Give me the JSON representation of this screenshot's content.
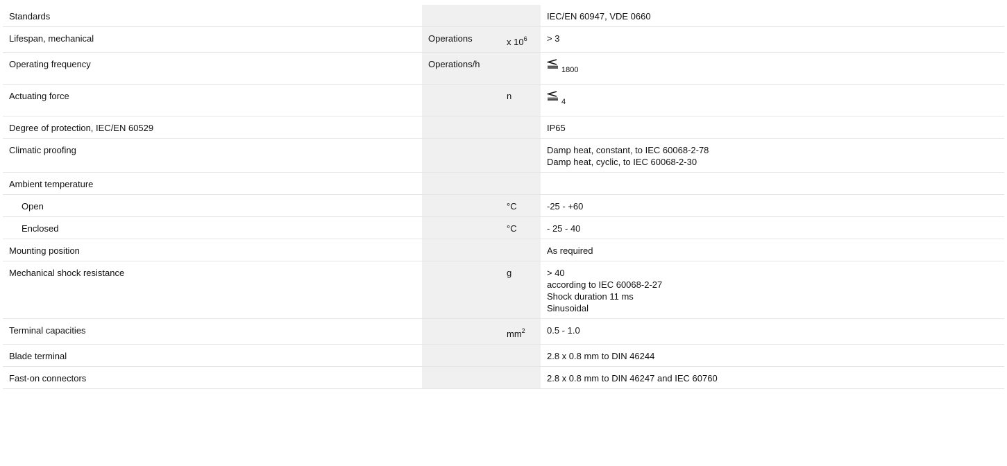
{
  "rows": [
    {
      "label": "Standards",
      "unit": "",
      "mult": "",
      "value": [
        "IEC/EN 60947, VDE 0660"
      ]
    },
    {
      "label": "Lifespan, mechanical",
      "unit": "Operations",
      "mult": "x 10",
      "mult_sup": "6",
      "value": [
        "> 3"
      ]
    },
    {
      "label": "Operating frequency",
      "unit": "Operations/h",
      "mult": "",
      "value_icon": "less-or-equal-icon",
      "value_sub": "1800"
    },
    {
      "label": "Actuating force",
      "unit": "",
      "mult": "n",
      "value_icon": "less-or-equal-icon",
      "value_sub": "4"
    },
    {
      "label": "Degree of protection, IEC/EN 60529",
      "unit": "",
      "mult": "",
      "value": [
        "IP65"
      ]
    },
    {
      "label": "Climatic proofing",
      "unit": "",
      "mult": "",
      "value": [
        "Damp heat, constant, to IEC 60068-2-78",
        "Damp heat, cyclic, to IEC 60068-2-30"
      ]
    },
    {
      "label": "Ambient temperature",
      "unit": "",
      "mult": "",
      "value": [
        ""
      ]
    },
    {
      "label": "Open",
      "indent": true,
      "unit": "",
      "mult": "°C",
      "value": [
        "-25 - +60"
      ]
    },
    {
      "label": "Enclosed",
      "indent": true,
      "unit": "",
      "mult": "°C",
      "value": [
        "- 25 - 40"
      ]
    },
    {
      "label": "Mounting position",
      "unit": "",
      "mult": "",
      "value": [
        "As required"
      ]
    },
    {
      "label": "Mechanical shock resistance",
      "unit": "",
      "mult": "g",
      "value": [
        "> 40",
        "according to IEC 60068-2-27",
        "Shock duration 11 ms",
        "Sinusoidal"
      ]
    },
    {
      "label": "Terminal capacities",
      "unit": "",
      "mult": "mm",
      "mult_sup": "2",
      "value": [
        "0.5 - 1.0"
      ]
    },
    {
      "label": "Blade terminal",
      "unit": "",
      "mult": "",
      "value": [
        "2.8 x 0.8 mm to DIN 46244"
      ]
    },
    {
      "label": "Fast-on connectors",
      "unit": "",
      "mult": "",
      "value": [
        "2.8 x 0.8 mm to DIN 46247 and IEC 60760"
      ]
    }
  ]
}
